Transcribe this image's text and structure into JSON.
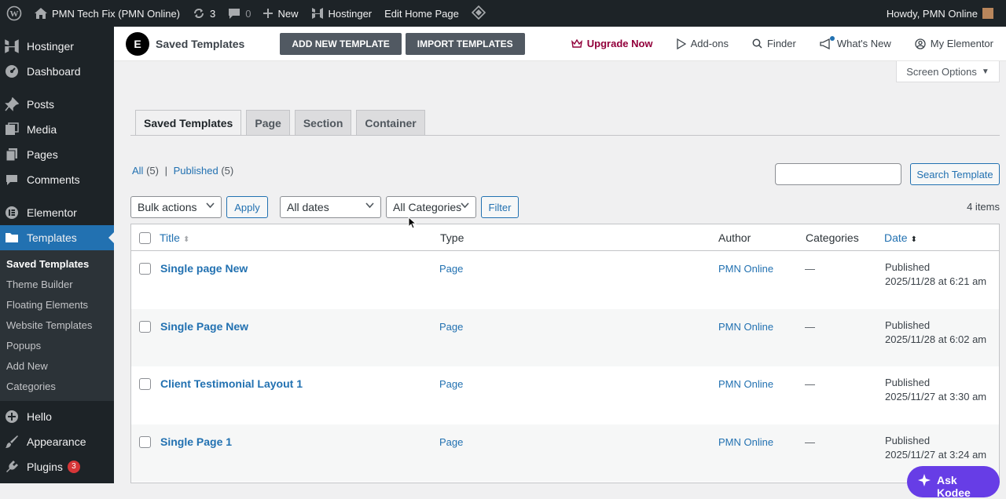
{
  "adminbar": {
    "site_name": "PMN Tech Fix (PMN Online)",
    "updates_count": "3",
    "comments_count": "0",
    "new_label": "New",
    "hostinger_label": "Hostinger",
    "edit_page_label": "Edit Home Page",
    "howdy": "Howdy, PMN Online"
  },
  "sidebar": {
    "items_top": [
      {
        "label": "Hostinger",
        "icon": "hostinger-icon"
      },
      {
        "label": "Dashboard",
        "icon": "dashboard-icon"
      },
      {
        "label": "Posts",
        "icon": "pin-icon"
      },
      {
        "label": "Media",
        "icon": "media-icon"
      },
      {
        "label": "Pages",
        "icon": "pages-icon"
      },
      {
        "label": "Comments",
        "icon": "comments-icon"
      },
      {
        "label": "Elementor",
        "icon": "elementor-icon"
      },
      {
        "label": "Templates",
        "icon": "folder-icon"
      }
    ],
    "submenu": [
      "Saved Templates",
      "Theme Builder",
      "Floating Elements",
      "Website Templates",
      "Popups",
      "Add New",
      "Categories"
    ],
    "items_bottom": [
      {
        "label": "Hello",
        "icon": "plus-circle-icon"
      },
      {
        "label": "Appearance",
        "icon": "brush-icon"
      },
      {
        "label": "Plugins",
        "icon": "plugin-icon",
        "badge": "3"
      }
    ]
  },
  "topbar": {
    "logo_letter": "E",
    "title": "Saved Templates",
    "add_new": "ADD NEW TEMPLATE",
    "import": "IMPORT TEMPLATES",
    "upgrade": "Upgrade Now",
    "addons": "Add-ons",
    "finder": "Finder",
    "whats_new": "What's New",
    "my_elementor": "My Elementor"
  },
  "screen_options": "Screen Options",
  "tabs": [
    "Saved Templates",
    "Page",
    "Section",
    "Container"
  ],
  "views": {
    "all": "All",
    "all_count": "(5)",
    "sep": "|",
    "published": "Published",
    "published_count": "(5)"
  },
  "search_button": "Search Template",
  "filters": {
    "bulk_actions": "Bulk actions",
    "apply": "Apply",
    "dates": "All dates",
    "categories": "All Categories",
    "filter": "Filter"
  },
  "items_count": "4 items",
  "table": {
    "headers": {
      "title": "Title",
      "type": "Type",
      "author": "Author",
      "categories": "Categories",
      "date": "Date"
    },
    "rows": [
      {
        "title": "Single page New",
        "type": "Page",
        "author": "PMN Online",
        "categories": "—",
        "status": "Published",
        "date": "2025/11/28 at 6:21 am"
      },
      {
        "title": "Single Page New",
        "type": "Page",
        "author": "PMN Online",
        "categories": "—",
        "status": "Published",
        "date": "2025/11/28 at 6:02 am"
      },
      {
        "title": "Client Testimonial Layout 1",
        "type": "Page",
        "author": "PMN Online",
        "categories": "—",
        "status": "Published",
        "date": "2025/11/27 at 3:30 am"
      },
      {
        "title": "Single Page 1",
        "type": "Page",
        "author": "PMN Online",
        "categories": "—",
        "status": "Published",
        "date": "2025/11/27 at 3:24 am"
      }
    ]
  },
  "ask_kodee": "Ask Kodee",
  "colors": {
    "admin_bg": "#1d2327",
    "accent": "#2271b1",
    "upgrade": "#92003b",
    "kodee": "#673de6"
  }
}
